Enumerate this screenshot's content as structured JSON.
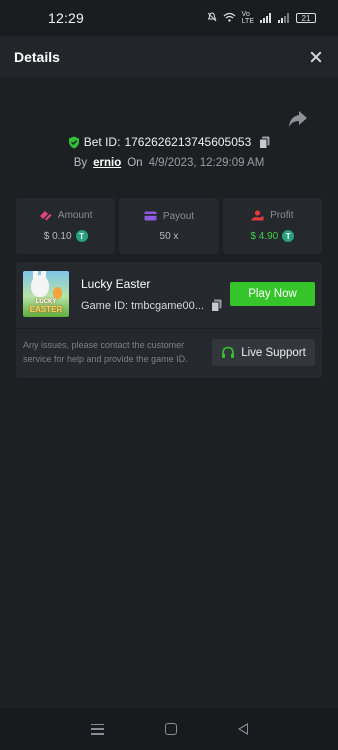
{
  "status_bar": {
    "time": "12:29",
    "battery": "21"
  },
  "header": {
    "title": "Details"
  },
  "bet": {
    "id_label": "Bet ID:",
    "id_value": "1762626213745605053",
    "by_label": "By",
    "username": "ernio",
    "on_label": "On",
    "datetime": "4/9/2023, 12:29:09 AM"
  },
  "stats": {
    "amount": {
      "label": "Amount",
      "value": "$ 0.10"
    },
    "payout": {
      "label": "Payout",
      "value": "50 x"
    },
    "profit": {
      "label": "Profit",
      "value": "$ 4.90"
    }
  },
  "game": {
    "name": "Lucky Easter",
    "id_text": "Game ID: tmbcgame00...",
    "thumb_line1": "LUCKY",
    "thumb_line2": "EASTER",
    "play_label": "Play Now",
    "notice": "Any issues, please contact the customer service for help and provide the game ID.",
    "support_label": "Live Support"
  },
  "colors": {
    "accent_green": "#36c42b",
    "profit_green": "#3fcf4a",
    "amount_icon": "#e0457b",
    "payout_icon": "#8e5be0",
    "profit_icon": "#e23b3b",
    "usdt": "#26a17b"
  }
}
